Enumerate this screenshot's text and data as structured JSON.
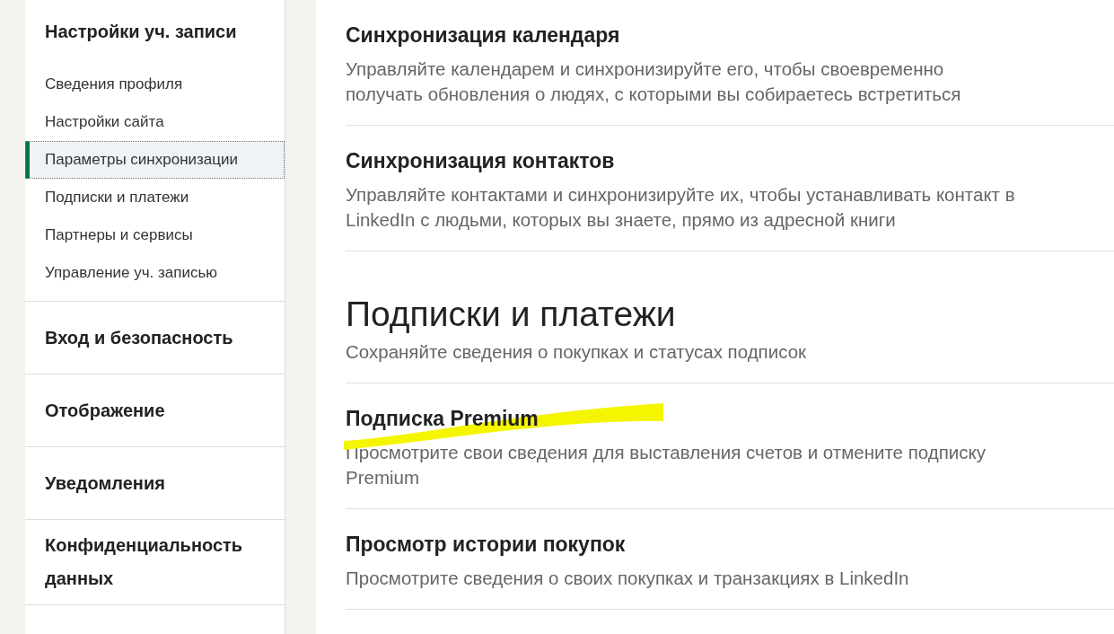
{
  "sidebar": {
    "title": "Настройки уч. записи",
    "items": [
      {
        "label": "Сведения профиля",
        "selected": false
      },
      {
        "label": "Настройки сайта",
        "selected": false
      },
      {
        "label": "Параметры синхронизации",
        "selected": true
      },
      {
        "label": "Подписки и платежи",
        "selected": false
      },
      {
        "label": "Партнеры и сервисы",
        "selected": false
      },
      {
        "label": "Управление уч. записью",
        "selected": false
      }
    ],
    "sections": [
      "Вход и безопасность",
      "Отображение",
      "Уведомления",
      "Конфиденциальность данных"
    ]
  },
  "main": [
    {
      "kind": "item",
      "title": "Синхронизация календаря",
      "description": "Управляйте календарем и синхронизируйте его, чтобы своевременно получать обновления о людях, с которыми вы собираетесь встретиться",
      "highlighted": false
    },
    {
      "kind": "item",
      "title": "Синхронизация контактов",
      "description": "Управляйте контактами и синхронизируйте их, чтобы устанавливать контакт в LinkedIn с людьми, которых вы знаете, прямо из адресной книги",
      "highlighted": false
    },
    {
      "kind": "heading",
      "title": "Подписки и платежи",
      "description": "Сохраняйте сведения о покупках и статусах подписок"
    },
    {
      "kind": "item",
      "title": "Подписка Premium",
      "description": "Просмотрите свои сведения для выставления счетов и отмените подписку Premium",
      "highlighted": true
    },
    {
      "kind": "item",
      "title": "Просмотр истории покупок",
      "description": "Просмотрите сведения о своих покупках и транзакциях в LinkedIn",
      "highlighted": false
    }
  ]
}
